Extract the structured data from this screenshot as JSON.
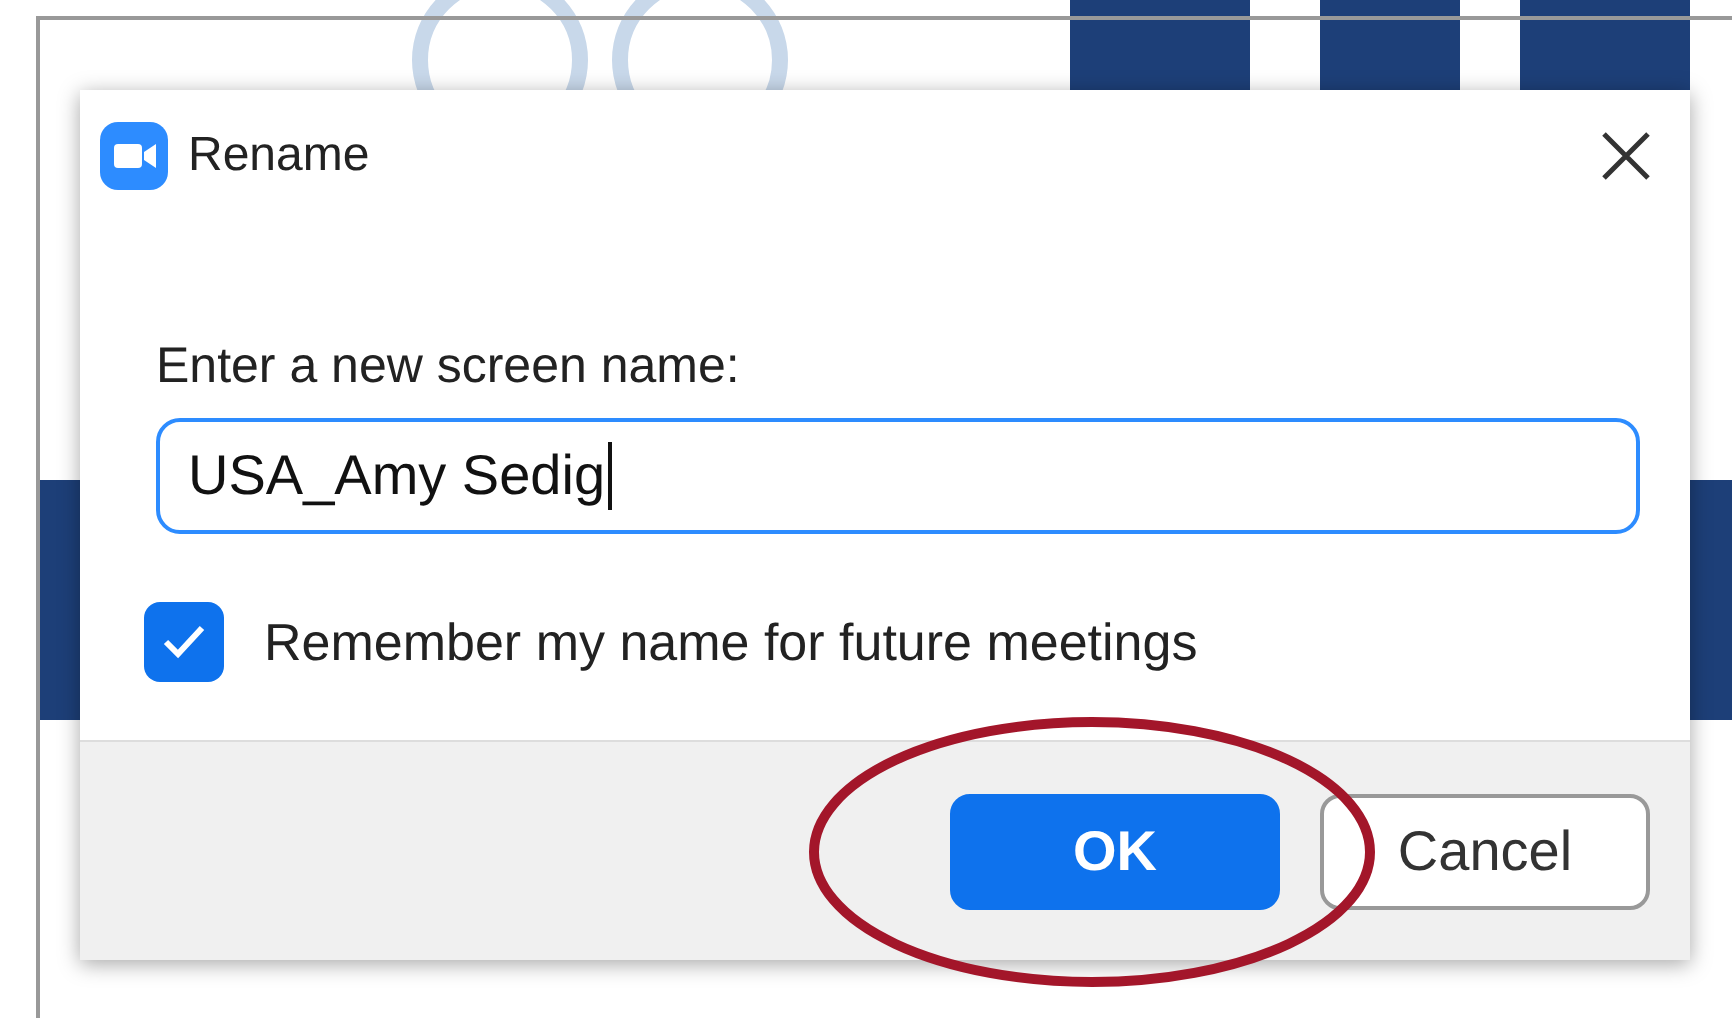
{
  "dialog": {
    "title": "Rename"
  },
  "prompt": "Enter a new screen name:",
  "name_field": {
    "value": "USA_Amy Sedig"
  },
  "remember": {
    "label": "Remember my name for future meetings",
    "checked": true
  },
  "buttons": [
    {
      "label": "OK",
      "kind": "primary"
    },
    {
      "label": "Cancel",
      "kind": "secondary"
    }
  ]
}
